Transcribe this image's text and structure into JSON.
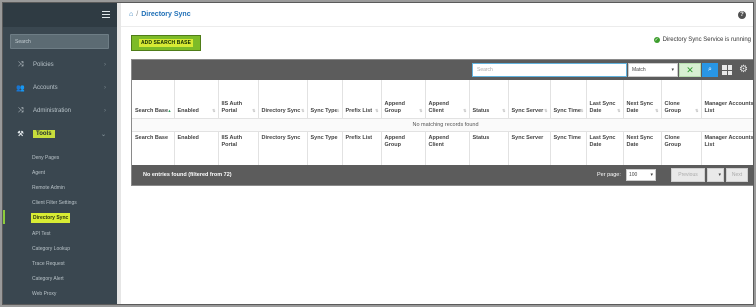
{
  "sidebar": {
    "search_placeholder": "Search",
    "menu": [
      {
        "label": "Policies",
        "icon": "shuffle-icon"
      },
      {
        "label": "Accounts",
        "icon": "users-icon"
      },
      {
        "label": "Administration",
        "icon": "shuffle-icon"
      },
      {
        "label": "Tools",
        "icon": "tools-icon"
      }
    ],
    "tools_sub": [
      "Deny Pages",
      "Agent",
      "Remote Admin",
      "Client Filter Settings",
      "Directory Sync",
      "API Test",
      "Category Lookup",
      "Trace Request",
      "Category Alert",
      "Web Proxy"
    ]
  },
  "header": {
    "breadcrumb": "Directory Sync"
  },
  "actions": {
    "add_search_base": "ADD SEARCH BASE"
  },
  "service": {
    "status_text": "Directory Sync Service is running"
  },
  "toolbar": {
    "search_placeholder": "Search",
    "match_option": "Match"
  },
  "table": {
    "columns": [
      "Search Base",
      "Enabled",
      "IIS Auth Portal",
      "Directory Sync",
      "Sync Type",
      "Prefix List",
      "Append Group",
      "Append Client",
      "Status",
      "Sync Server",
      "Sync Time",
      "Last Sync Date",
      "Next Sync Date",
      "Clone Group",
      "Manager Accounts List"
    ],
    "empty_message": "No matching records found"
  },
  "footer": {
    "info": "No entries found (filtered from 72)",
    "per_page_label": "Per page:",
    "per_page_value": "100",
    "prev_label": "Previous",
    "next_label": "Next"
  }
}
